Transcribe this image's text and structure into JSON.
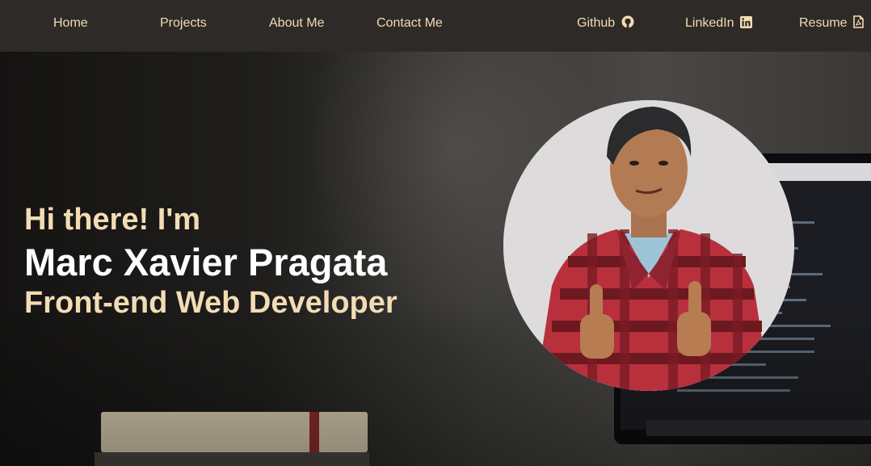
{
  "nav": {
    "home": "Home",
    "projects": "Projects",
    "about": "About Me",
    "contact": "Contact Me",
    "github": "Github",
    "linkedin": "LinkedIn",
    "resume": "Resume"
  },
  "icons": {
    "github": "github-icon",
    "linkedin": "linkedin-icon",
    "resume": "pdf-icon"
  },
  "hero": {
    "greeting": "Hi there! I'm",
    "name": "Marc Xavier Pragata",
    "role": "Front-end Web Developer"
  },
  "colors": {
    "accent": "#f3dcb4",
    "navbar": "#2e2a28",
    "name_text": "#ffffff"
  }
}
